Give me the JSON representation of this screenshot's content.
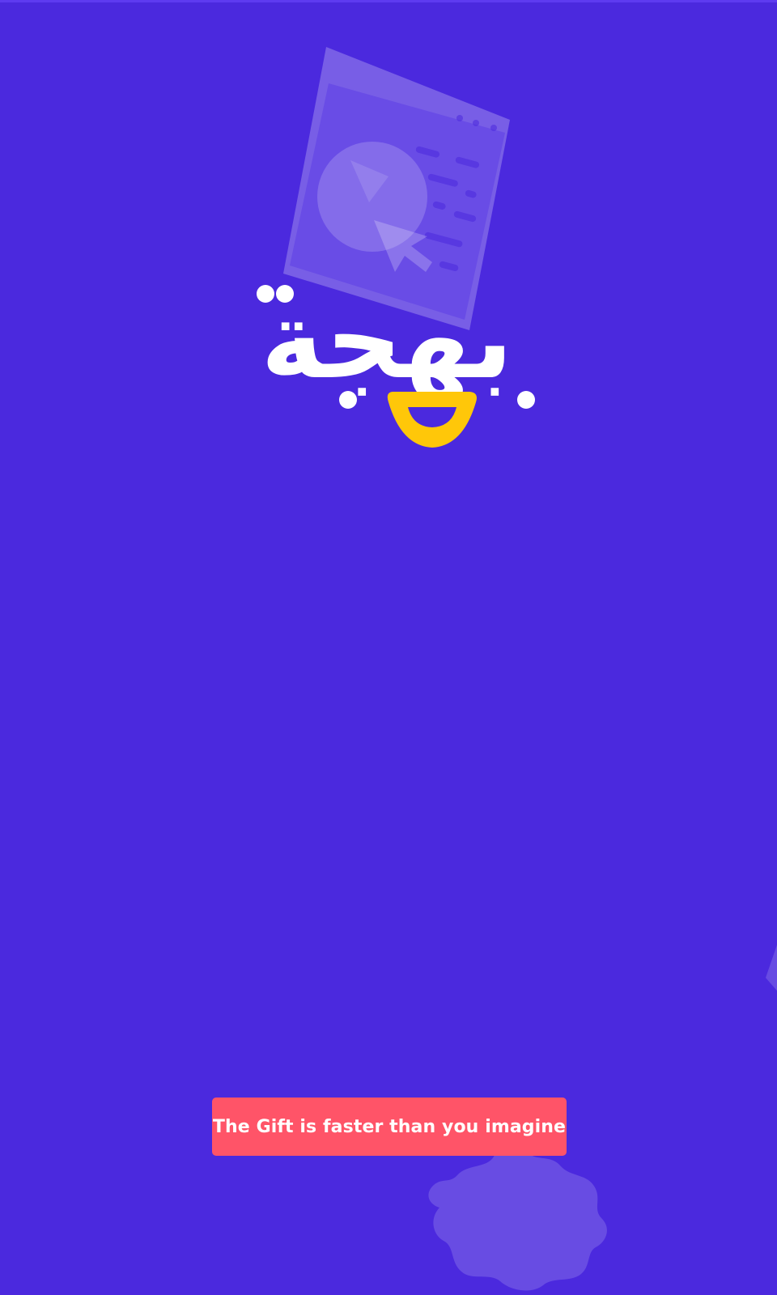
{
  "app": {
    "brand_name": "بهجة",
    "tagline": "The Gift is faster than you imagine"
  },
  "colors": {
    "background": "#4b29de",
    "logo_primary": "#ffffff",
    "logo_accent": "#ffc709",
    "button_background": "#ff5468",
    "button_text": "#ffffff",
    "illustration": "#7052e6"
  },
  "icons": {
    "logo": "bahja-smile-logo",
    "background_top": "browser-window-cursor-icon",
    "background_bottom": "gift-box-icon",
    "background_right": "diamond-icon"
  }
}
